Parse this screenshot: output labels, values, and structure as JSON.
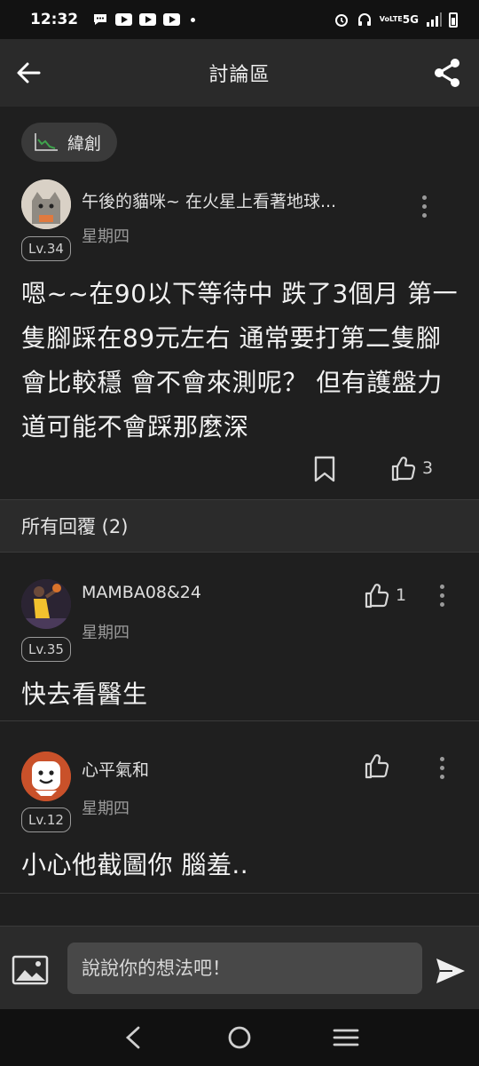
{
  "status_bar": {
    "time": "12:32",
    "network": "5G",
    "volte": "VoLTE"
  },
  "header": {
    "title": "討論區"
  },
  "post": {
    "tag": "緯創",
    "author": "午後的貓咪~ 在火星上看著地球...",
    "level": "Lv.34",
    "date": "星期四",
    "body": "嗯~~在90以下等待中 跌了3個月 第一隻腳踩在89元左右 通常要打第二隻腳會比較穩 會不會來測呢？ 但有護盤力道可能不會踩那麼深",
    "like_count": "3"
  },
  "replies_header": "所有回覆 (2)",
  "replies": [
    {
      "author": "MAMBA08&24",
      "level": "Lv.35",
      "date": "星期四",
      "text": "快去看醫生",
      "like_count": "1"
    },
    {
      "author": "心平氣和",
      "level": "Lv.12",
      "date": "星期四",
      "text": "小心他截圖你 腦羞..",
      "like_count": ""
    }
  ],
  "comment_input": {
    "placeholder": "說說你的想法吧！"
  },
  "colors": {
    "background": "#1f1f1f",
    "header": "#2a2a2a",
    "accent_green": "#3fa34d"
  }
}
